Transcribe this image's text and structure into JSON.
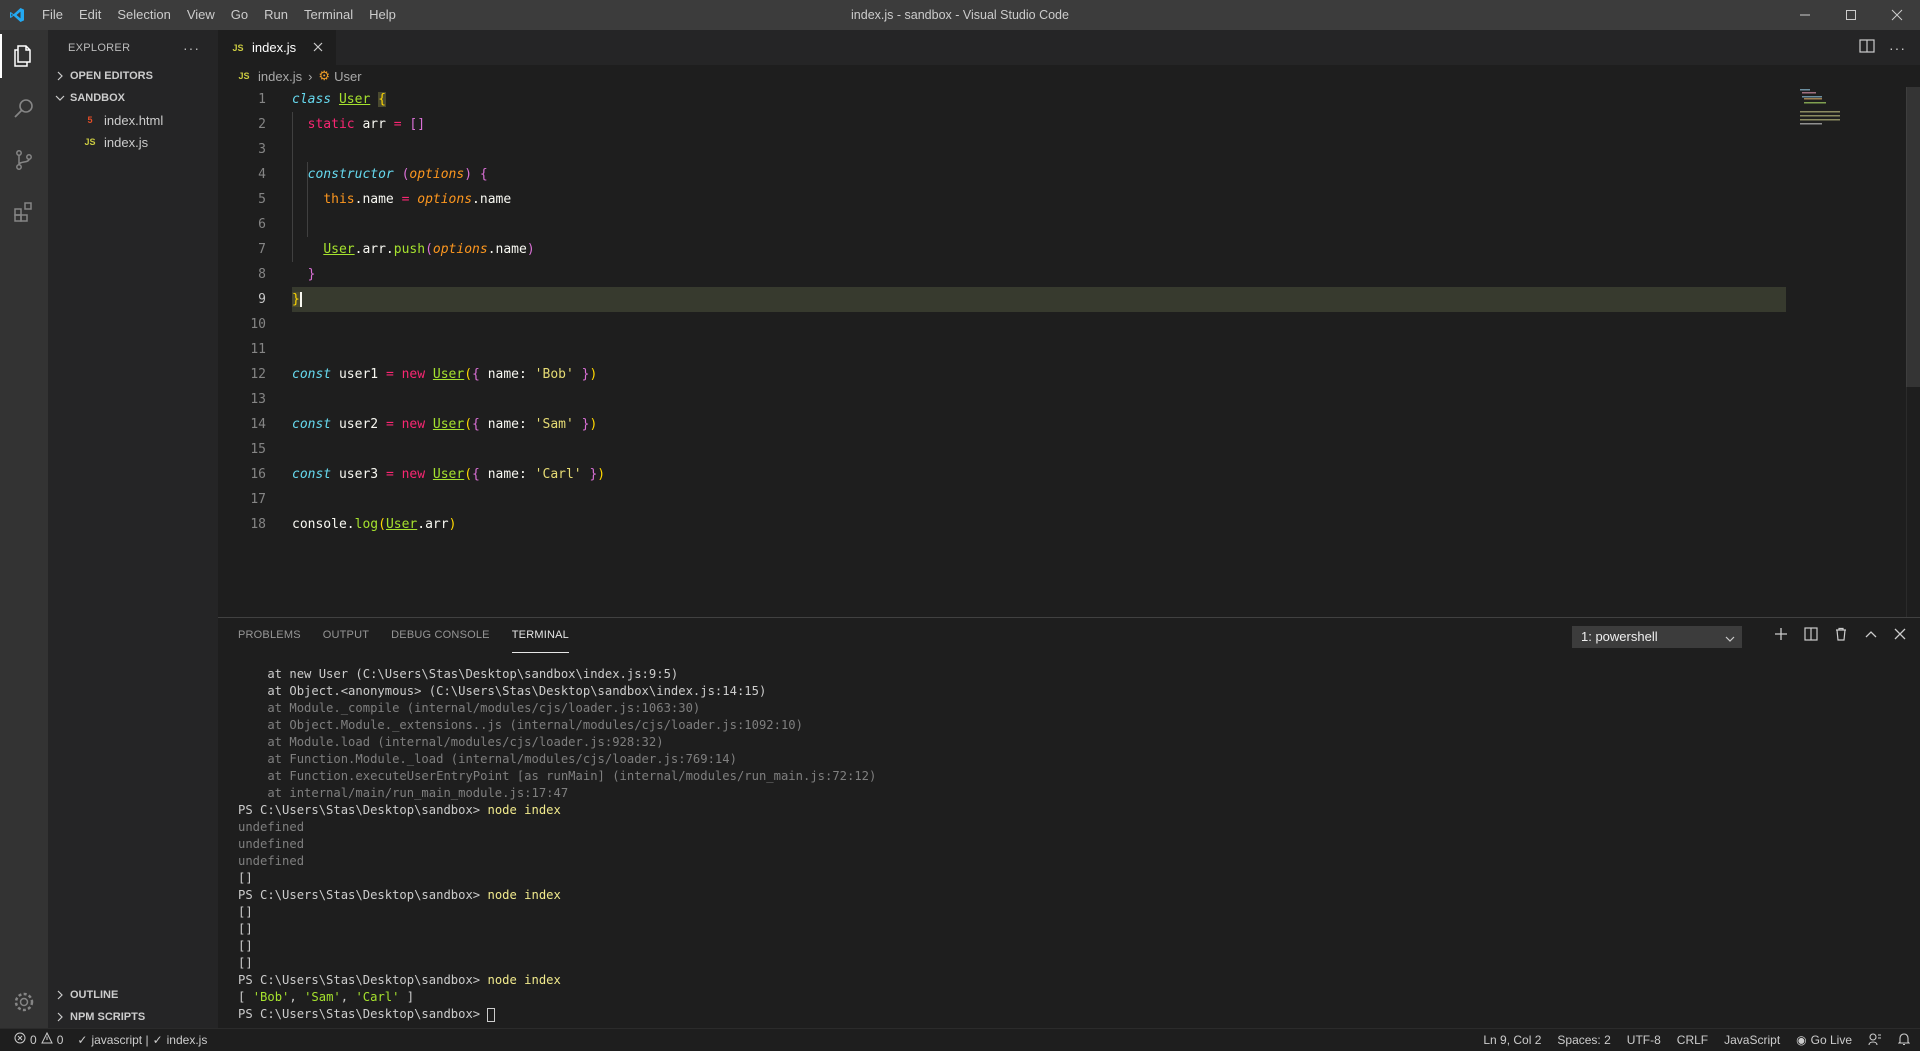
{
  "window": {
    "title": "index.js - sandbox - Visual Studio Code",
    "menu": [
      "File",
      "Edit",
      "Selection",
      "View",
      "Go",
      "Run",
      "Terminal",
      "Help"
    ]
  },
  "sidebar": {
    "header": "EXPLORER",
    "sections": {
      "open_editors": "OPEN EDITORS",
      "folder": "SANDBOX",
      "outline": "OUTLINE",
      "npm_scripts": "NPM SCRIPTS"
    },
    "files": [
      {
        "name": "index.html",
        "icon": "html-file-icon"
      },
      {
        "name": "index.js",
        "icon": "js-file-icon"
      }
    ]
  },
  "editor": {
    "tab_label": "index.js",
    "breadcrumb": {
      "file": "index.js",
      "symbol": "User"
    },
    "line_numbers": [
      "1",
      "2",
      "3",
      "4",
      "5",
      "6",
      "7",
      "8",
      "9",
      "10",
      "11",
      "12",
      "13",
      "14",
      "15",
      "16",
      "17",
      "18"
    ],
    "active_line": 9
  },
  "panel": {
    "tabs": [
      "PROBLEMS",
      "OUTPUT",
      "DEBUG CONSOLE",
      "TERMINAL"
    ],
    "active_tab": "TERMINAL",
    "terminal_select": "1: powershell",
    "terminal_lines": [
      {
        "text": "    at new User (C:\\Users\\Stas\\Desktop\\sandbox\\index.js:9:5)",
        "style": "normal"
      },
      {
        "text": "    at Object.<anonymous> (C:\\Users\\Stas\\Desktop\\sandbox\\index.js:14:15)",
        "style": "normal"
      },
      {
        "text": "    at Module._compile (internal/modules/cjs/loader.js:1063:30)",
        "style": "dim"
      },
      {
        "text": "    at Object.Module._extensions..js (internal/modules/cjs/loader.js:1092:10)",
        "style": "dim"
      },
      {
        "text": "    at Module.load (internal/modules/cjs/loader.js:928:32)",
        "style": "dim"
      },
      {
        "text": "    at Function.Module._load (internal/modules/cjs/loader.js:769:14)",
        "style": "dim"
      },
      {
        "text": "    at Function.executeUserEntryPoint [as runMain] (internal/modules/run_main.js:72:12)",
        "style": "dim"
      },
      {
        "text": "    at internal/main/run_main_module.js:17:47",
        "style": "dim"
      },
      {
        "prompt": "PS C:\\Users\\Stas\\Desktop\\sandbox> ",
        "cmd": "node index"
      },
      {
        "text": "undefined",
        "style": "dim"
      },
      {
        "text": "undefined",
        "style": "dim"
      },
      {
        "text": "undefined",
        "style": "dim"
      },
      {
        "text": "[]",
        "style": "normal"
      },
      {
        "prompt": "PS C:\\Users\\Stas\\Desktop\\sandbox> ",
        "cmd": "node index"
      },
      {
        "text": "[]",
        "style": "normal"
      },
      {
        "text": "[]",
        "style": "normal"
      },
      {
        "text": "[]",
        "style": "normal"
      },
      {
        "text": "[]",
        "style": "normal"
      },
      {
        "prompt": "PS C:\\Users\\Stas\\Desktop\\sandbox> ",
        "cmd": "node index"
      },
      {
        "result": [
          "[ ",
          "'Bob'",
          ", ",
          "'Sam'",
          ", ",
          "'Carl'",
          " ]"
        ]
      },
      {
        "prompt": "PS C:\\Users\\Stas\\Desktop\\sandbox> ",
        "cmd": "",
        "cursor": true
      }
    ]
  },
  "statusbar": {
    "errors": "0",
    "warnings": "0",
    "lint_js": "javascript |",
    "lint_file": "index.js",
    "position": "Ln 9, Col 2",
    "spaces": "Spaces: 2",
    "encoding": "UTF-8",
    "eol": "CRLF",
    "language": "JavaScript",
    "go_live": "Go Live"
  },
  "colors": {
    "titlebar": "#3c3c3c",
    "activitybar": "#333333",
    "sidebar": "#252526",
    "editor": "#1e1e1e",
    "keyword": "#f92672",
    "class_name": "#a6e22e",
    "storage_italic": "#66d9ef",
    "string": "#e6db74",
    "parameter": "#fd971f"
  }
}
